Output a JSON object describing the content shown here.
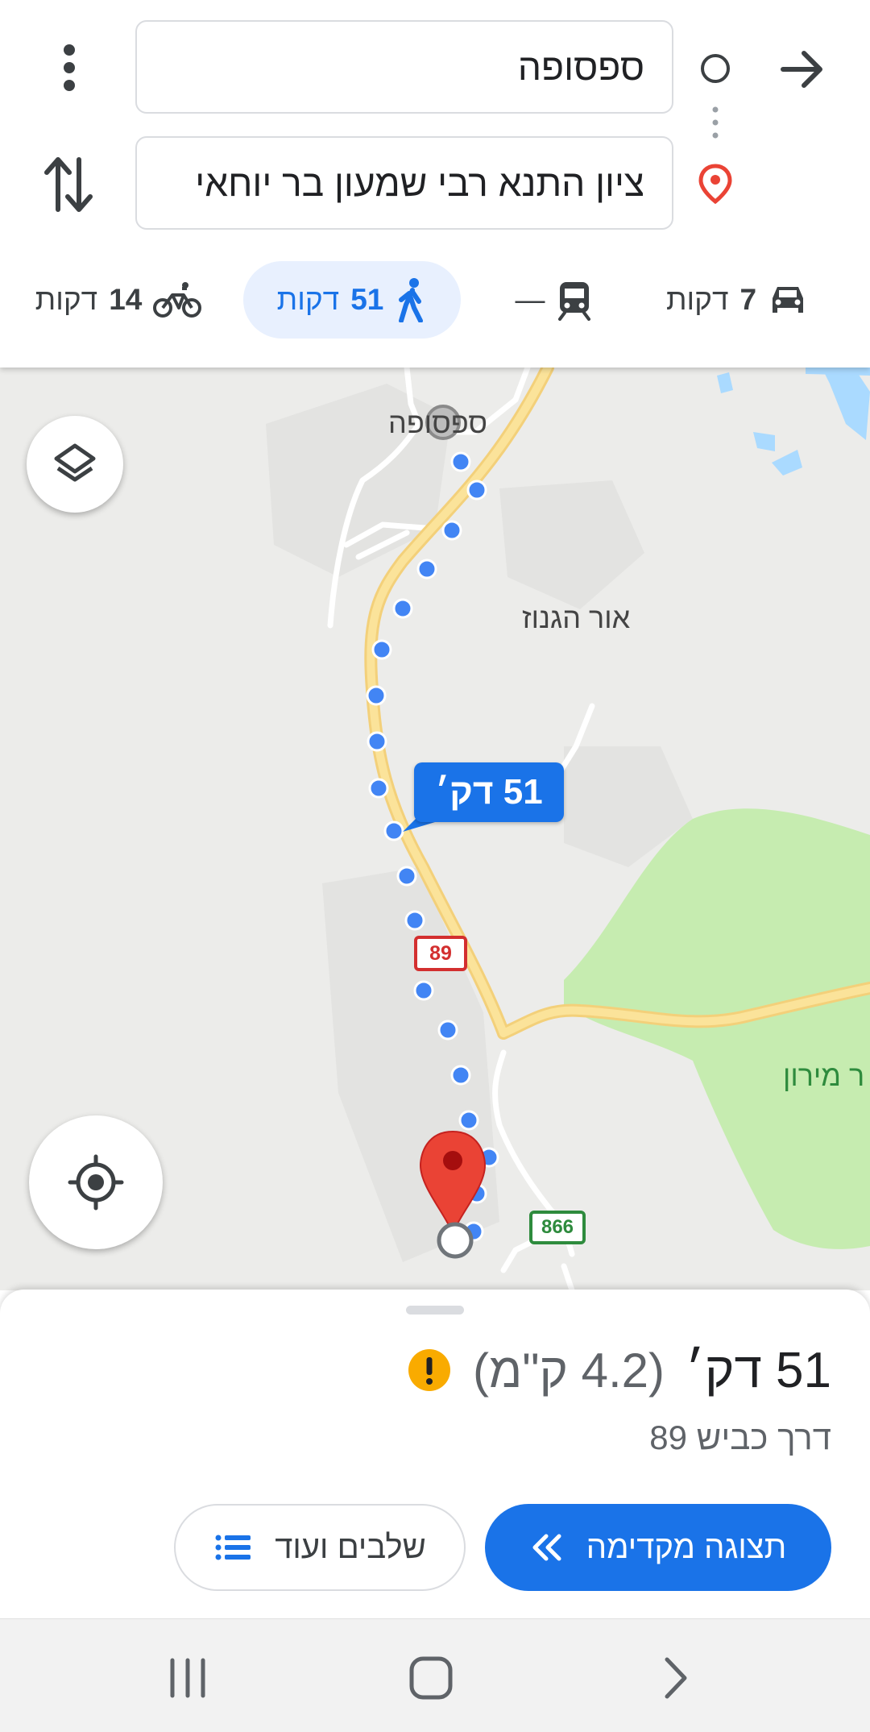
{
  "header": {
    "origin": "ספסופה",
    "destination": "ציון התנא רבי שמעון בר יוחאי",
    "more_icon": "more-vert-icon",
    "swap_icon": "swap-vertical-icon",
    "back_icon": "arrow-icon"
  },
  "modes": [
    {
      "id": "car",
      "icon": "car-icon",
      "num": "7",
      "unit": "דקות"
    },
    {
      "id": "transit",
      "icon": "train-icon",
      "num": "—",
      "unit": ""
    },
    {
      "id": "walk",
      "icon": "walk-icon",
      "num": "51",
      "unit": "דקות",
      "active": true
    },
    {
      "id": "bike",
      "icon": "bike-icon",
      "num": "14",
      "unit": "דקות"
    }
  ],
  "map": {
    "labels": {
      "origin_town": "ספסופה",
      "neighborhood": "אור הגנוז",
      "park": "ר מירון"
    },
    "route_eta": "51 דק׳",
    "road_shields": {
      "road_89": "89",
      "road_866": "866"
    },
    "layers_icon": "layers-icon",
    "location_icon": "my-location-icon"
  },
  "summary": {
    "duration": "51 דק׳",
    "distance": "(4.2 ק\"מ)",
    "via": "דרך כביש 89",
    "warning_icon": "warning-icon"
  },
  "actions": {
    "preview_label": "תצוגה מקדימה",
    "steps_label": "שלבים ועוד"
  },
  "nav": {
    "recents_icon": "recent-apps-icon",
    "home_icon": "home-icon",
    "back_icon": "back-chevron-icon"
  },
  "colors": {
    "accent": "#1a73e8",
    "route_dots": "#4285f4",
    "pin": "#ea4335",
    "highway": "#fbe39a",
    "park": "#c6ecb0",
    "warning": "#f9ab00"
  }
}
